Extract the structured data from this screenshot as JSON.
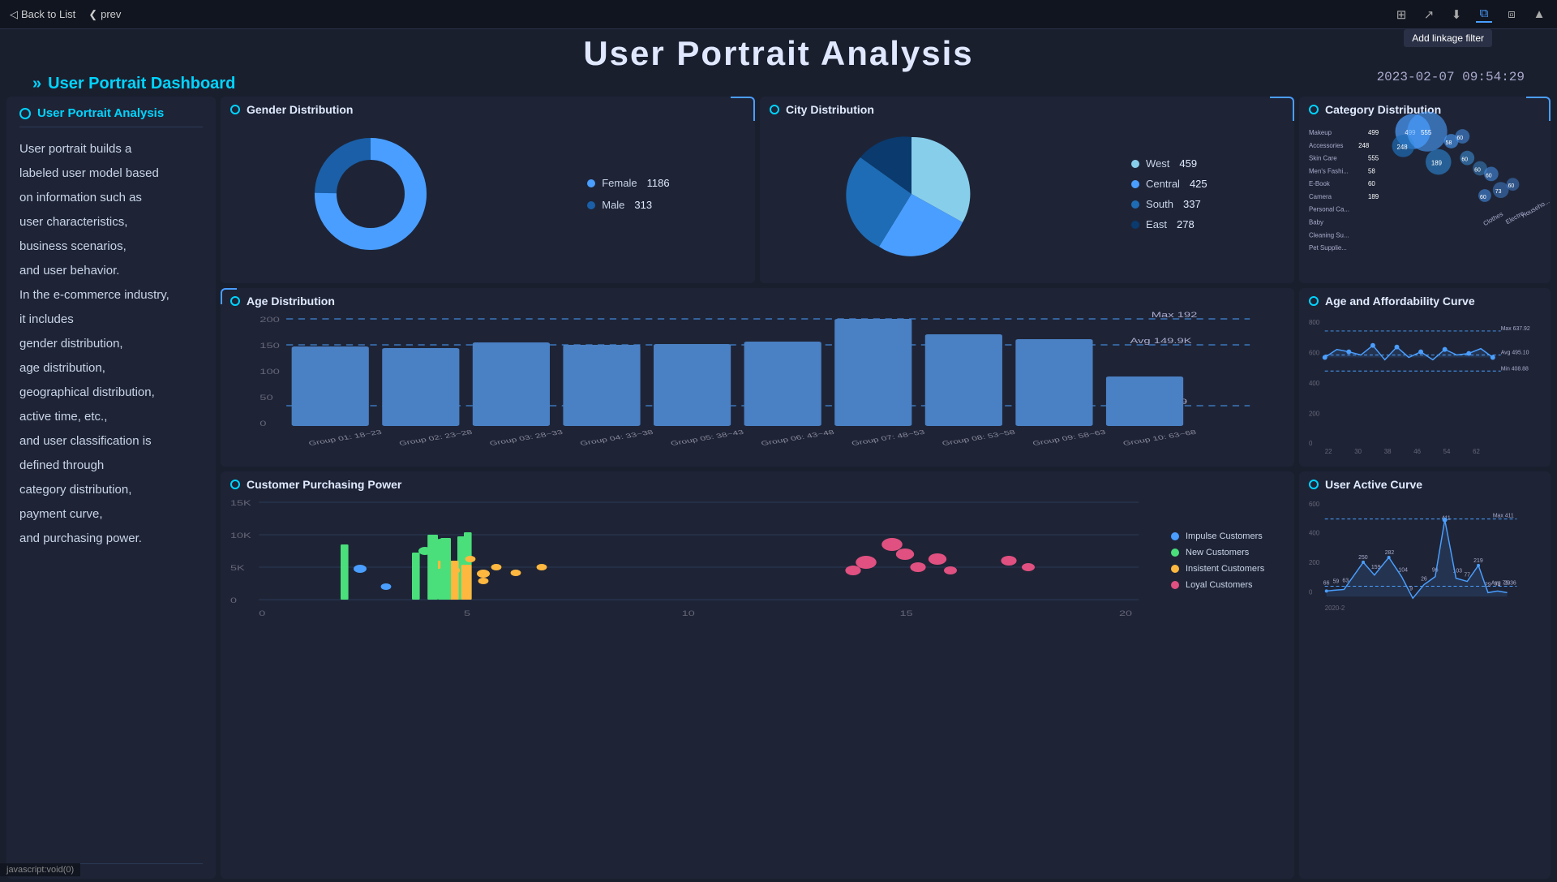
{
  "nav": {
    "back_label": "Back to List",
    "prev_label": "prev",
    "tooltip": "Add linkage filter",
    "datetime": "2023-02-07 09:54:29"
  },
  "header": {
    "main_title": "User Portrait Analysis",
    "subtitle": "User Portrait Dashboard"
  },
  "left_panel": {
    "title": "User Portrait Analysis",
    "description": [
      "User portrait builds a",
      "labeled user model based",
      "on information such as",
      "user characteristics,",
      "business scenarios,",
      "and user behavior.",
      "In the e-commerce industry,",
      "it includes",
      "gender distribution,",
      "age distribution,",
      "geographical distribution,",
      "active time, etc.,",
      "and user classification is",
      "defined through",
      "category distribution,",
      "payment curve,",
      "and purchasing power."
    ]
  },
  "gender_chart": {
    "title": "Gender Distribution",
    "female_label": "Female",
    "female_value": 1186,
    "female_color": "#4a9eff",
    "male_label": "Male",
    "male_value": 313,
    "male_color": "#1a5fa8"
  },
  "city_chart": {
    "title": "City Distribution",
    "items": [
      {
        "label": "West",
        "value": 459,
        "color": "#87ceeb"
      },
      {
        "label": "Central",
        "value": 425,
        "color": "#4a9eff"
      },
      {
        "label": "South",
        "value": 337,
        "color": "#1e6cb5"
      },
      {
        "label": "East",
        "value": 278,
        "color": "#0a3a6e"
      }
    ]
  },
  "age_chart": {
    "title": "Age Distribution",
    "max_label": "Max 192",
    "avg_label": "Avg 149.9K",
    "min_label": "Min 89",
    "y_labels": [
      "200",
      "150",
      "100",
      "50",
      "0"
    ],
    "groups": [
      {
        "label": "Group 01: 18~23",
        "value": 140
      },
      {
        "label": "Group 02: 23~28",
        "value": 138
      },
      {
        "label": "Group 03: 28~33",
        "value": 148
      },
      {
        "label": "Group 04: 33~38",
        "value": 143
      },
      {
        "label": "Group 05: 38~43",
        "value": 145
      },
      {
        "label": "Group 06: 43~48",
        "value": 150
      },
      {
        "label": "Group 07: 48~53",
        "value": 192
      },
      {
        "label": "Group 08: 53~58",
        "value": 165
      },
      {
        "label": "Group 09: 58~63",
        "value": 155
      },
      {
        "label": "Group 10: 63~68",
        "value": 89
      }
    ]
  },
  "purchasing_chart": {
    "title": "Customer Purchasing Power",
    "legend": [
      {
        "label": "Impulse Customers",
        "color": "#4a9eff"
      },
      {
        "label": "New Customers",
        "color": "#4adf7a"
      },
      {
        "label": "Insistent Customers",
        "color": "#ffb83f"
      },
      {
        "label": "Loyal Customers",
        "color": "#e05080"
      }
    ],
    "y_labels": [
      "15K",
      "10K",
      "5K",
      "0"
    ],
    "x_labels": [
      "0",
      "5",
      "10",
      "15",
      "20"
    ]
  },
  "category_chart": {
    "title": "Category Distribution",
    "items": [
      {
        "label": "Makeup",
        "value": 499
      },
      {
        "label": "Accessories",
        "value": 248
      },
      {
        "label": "Skin Care",
        "value": 555
      },
      {
        "label": "Men's Fashi...",
        "value": 58
      },
      {
        "label": "E-Book",
        "value": 60
      },
      {
        "label": "Camera",
        "value": 189
      },
      {
        "label": "Personal Ca...",
        "value": 60
      },
      {
        "label": "Baby",
        "value": 73
      },
      {
        "label": "Cleaning Su...",
        "value": 60
      },
      {
        "label": "Pet Supplie...",
        "value": 60
      },
      {
        "label": "Clothes",
        "value": 60
      },
      {
        "label": "Electro...",
        "value": 60
      },
      {
        "label": "Househo...",
        "value": 60
      }
    ]
  },
  "affordability_chart": {
    "title": "Age and Affordability Curve",
    "max_label": "Max 637.92",
    "avg_label": "Avg 495.10",
    "min_label": "Min 408.88",
    "y_labels": [
      "800",
      "600",
      "400",
      "200",
      "0"
    ],
    "x_labels": [
      "22",
      "30",
      "38",
      "46",
      "54",
      "62"
    ]
  },
  "active_curve_chart": {
    "title": "User Active Curve",
    "max_label": "Max 411",
    "avg_label": "Avg 79.36",
    "y_labels": [
      "600",
      "400",
      "200",
      "0"
    ],
    "x_label": "2020-2",
    "data_points": [
      {
        "x": 0,
        "v": 66
      },
      {
        "x": 1,
        "v": 59
      },
      {
        "x": 2,
        "v": 63
      },
      {
        "x": 3,
        "v": 250
      },
      {
        "x": 4,
        "v": 159
      },
      {
        "x": 5,
        "v": 282
      },
      {
        "x": 6,
        "v": 104
      },
      {
        "x": 7,
        "v": 9
      },
      {
        "x": 8,
        "v": 26
      },
      {
        "x": 9,
        "v": 96
      },
      {
        "x": 10,
        "v": 411
      },
      {
        "x": 11,
        "v": 103
      },
      {
        "x": 12,
        "v": 77
      },
      {
        "x": 13,
        "v": 219
      },
      {
        "x": 14,
        "v": 29
      },
      {
        "x": 15,
        "v": 32
      },
      {
        "x": 16,
        "v": 29
      },
      {
        "x": 17,
        "v": 58
      },
      {
        "x": 18,
        "v": 55
      }
    ]
  },
  "status_bar": {
    "text": "javascript:void(0)"
  },
  "icons": {
    "back_arrow": "◁",
    "prev_arrow": "❮",
    "share": "⤴",
    "export": "⎘",
    "filter": "⧉",
    "copy": "⧉",
    "chevron_up": "▲",
    "bookmark": "🔖"
  }
}
